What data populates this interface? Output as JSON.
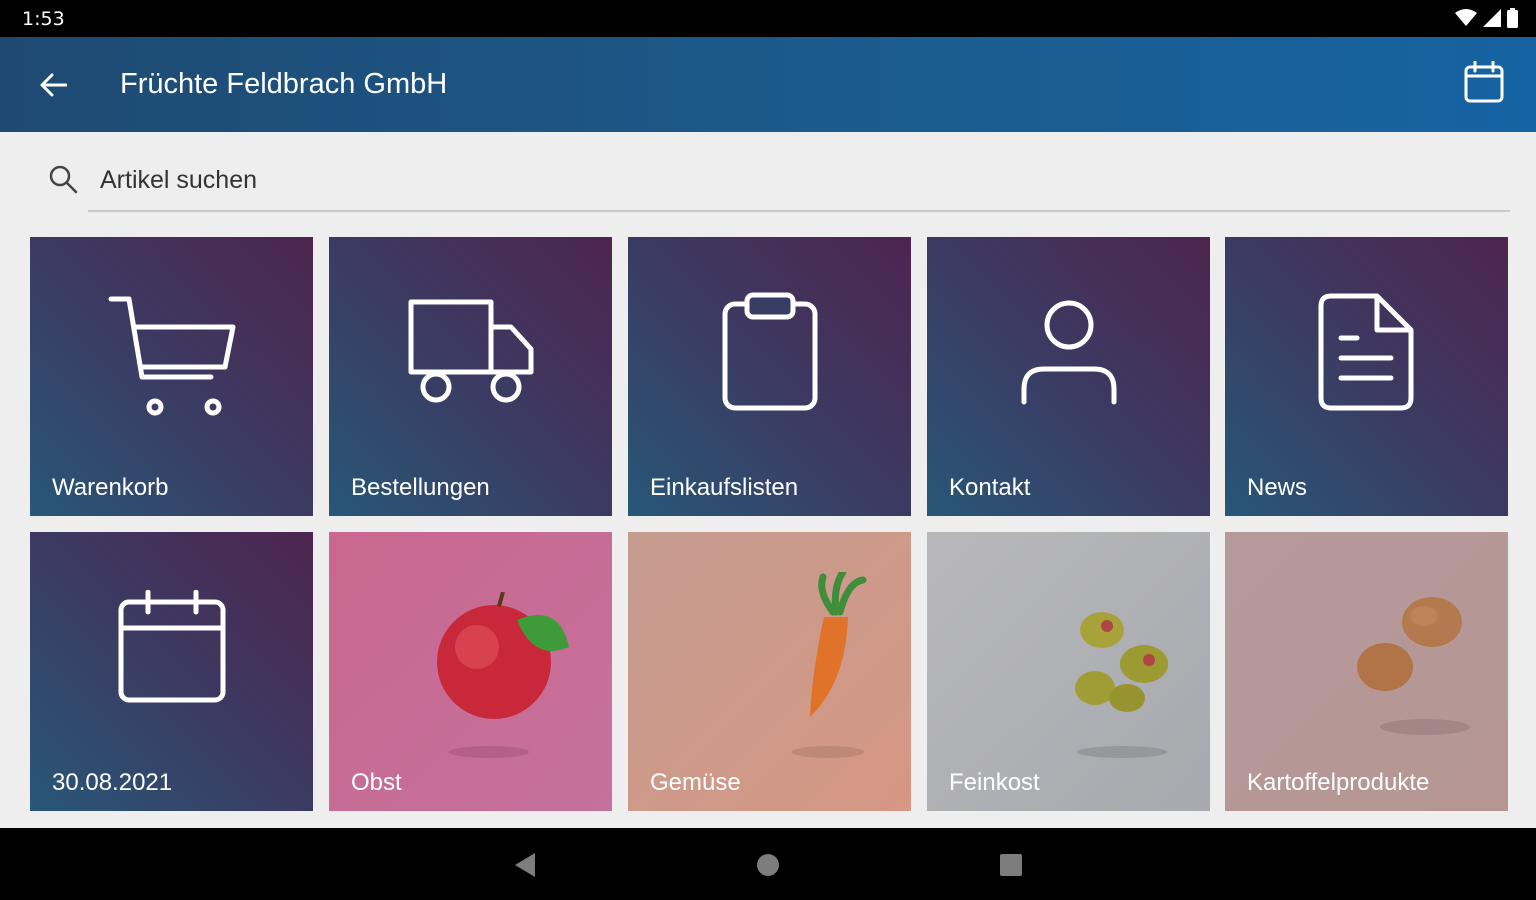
{
  "status": {
    "time": "1:53"
  },
  "appbar": {
    "title": "Früchte Feldbrach GmbH"
  },
  "search": {
    "placeholder": "Artikel suchen"
  },
  "tiles": [
    {
      "label": "Warenkorb",
      "icon": "cart-icon"
    },
    {
      "label": "Bestellungen",
      "icon": "truck-icon"
    },
    {
      "label": "Einkaufslisten",
      "icon": "clipboard-icon"
    },
    {
      "label": "Kontakt",
      "icon": "person-icon"
    },
    {
      "label": "News",
      "icon": "document-icon"
    },
    {
      "label": "30.08.2021",
      "icon": "calendar-icon"
    },
    {
      "label": "Obst",
      "icon": "apple-icon"
    },
    {
      "label": "Gemüse",
      "icon": "carrot-icon"
    },
    {
      "label": "Feinkost",
      "icon": "olives-icon"
    },
    {
      "label": "Kartoffelprodukte",
      "icon": "potatoes-icon"
    }
  ],
  "colors": {
    "appbar": "#1b5c8e",
    "tile_nav": "#3c3a62"
  }
}
